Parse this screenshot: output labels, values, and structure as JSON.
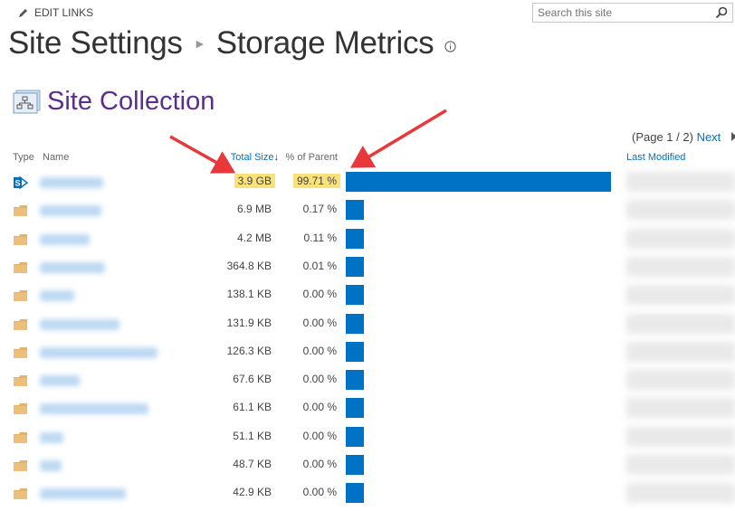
{
  "top_bar": {
    "edit_links_label": "EDIT LINKS",
    "search_placeholder": "Search this site"
  },
  "breadcrumb": {
    "parent": "Site Settings",
    "current": "Storage Metrics"
  },
  "section": {
    "title": "Site Collection",
    "title_color": "#5c2d91"
  },
  "pager": {
    "text": "(Page 1 / 2)",
    "next_label": "Next"
  },
  "table": {
    "columns": {
      "type": "Type",
      "name": "Name",
      "total_size": "Total Size",
      "sort_indicator": "↓",
      "percent_of_parent": "% of Parent",
      "last_modified": "Last Modified"
    },
    "bar_color": "#0072c6",
    "highlight_color": "#f9e27a",
    "rows": [
      {
        "icon": "sharepoint-site-icon",
        "name": "(blurred)",
        "total_size": "3.9 GB",
        "percent_of_parent": "99.71 %",
        "percent_value": 99.71,
        "highlighted": true
      },
      {
        "icon": "folder-icon",
        "name": "(blurred)",
        "total_size": "6.9 MB",
        "percent_of_parent": "0.17 %",
        "percent_value": 0.17
      },
      {
        "icon": "folder-icon",
        "name": "(blurred)",
        "total_size": "4.2 MB",
        "percent_of_parent": "0.11 %",
        "percent_value": 0.11
      },
      {
        "icon": "folder-icon",
        "name": "(blurred)",
        "total_size": "364.8 KB",
        "percent_of_parent": "0.01 %",
        "percent_value": 0.01
      },
      {
        "icon": "folder-icon",
        "name": "(blurred)",
        "total_size": "138.1 KB",
        "percent_of_parent": "0.00 %",
        "percent_value": 0.0
      },
      {
        "icon": "folder-icon",
        "name": "(blurred)",
        "total_size": "131.9 KB",
        "percent_of_parent": "0.00 %",
        "percent_value": 0.0
      },
      {
        "icon": "folder-icon",
        "name": "(blurred)",
        "total_size": "126.3 KB",
        "percent_of_parent": "0.00 %",
        "percent_value": 0.0
      },
      {
        "icon": "folder-icon",
        "name": "(blurred)",
        "total_size": "67.6 KB",
        "percent_of_parent": "0.00 %",
        "percent_value": 0.0
      },
      {
        "icon": "folder-icon",
        "name": "(blurred)",
        "total_size": "61.1 KB",
        "percent_of_parent": "0.00 %",
        "percent_value": 0.0
      },
      {
        "icon": "folder-icon",
        "name": "(blurred)",
        "total_size": "51.1 KB",
        "percent_of_parent": "0.00 %",
        "percent_value": 0.0
      },
      {
        "icon": "folder-icon",
        "name": "(blurred)",
        "total_size": "48.7 KB",
        "percent_of_parent": "0.00 %",
        "percent_value": 0.0
      },
      {
        "icon": "folder-icon",
        "name": "(blurred)",
        "total_size": "42.9 KB",
        "percent_of_parent": "0.00 %",
        "percent_value": 0.0
      }
    ]
  },
  "annotations": {
    "arrow_color": "#e8383b",
    "arrows": [
      "points-to-total-size",
      "points-to-percent-bar"
    ]
  }
}
